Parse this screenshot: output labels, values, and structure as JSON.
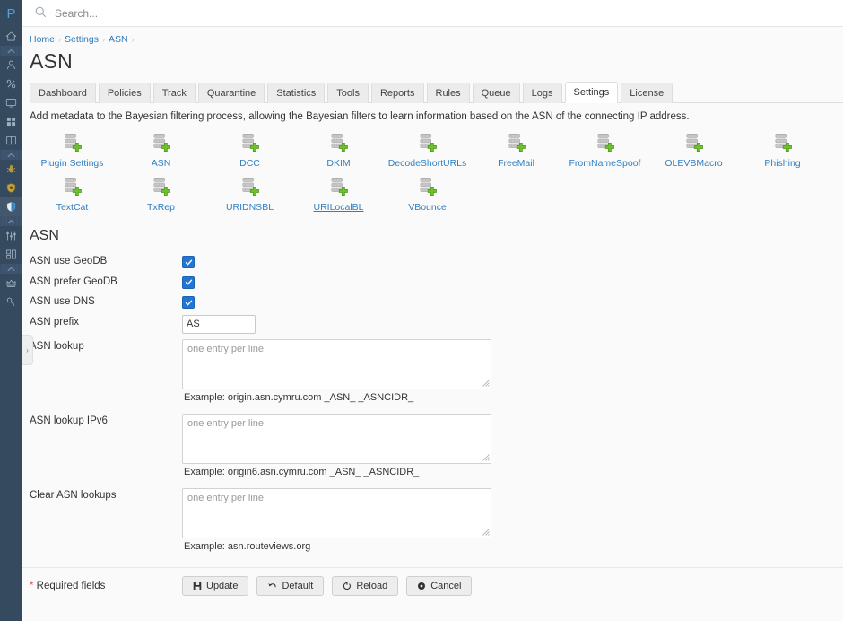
{
  "sidebar": {
    "logo": "P",
    "items": [
      {
        "name": "home-icon",
        "label": "Home",
        "type": "item",
        "active": false
      },
      {
        "name": "chevron-up-icon",
        "label": "",
        "type": "sep",
        "active": false
      },
      {
        "name": "user-icon",
        "label": "Users",
        "type": "item",
        "active": false
      },
      {
        "name": "percent-icon",
        "label": "Rates",
        "type": "item",
        "active": false
      },
      {
        "name": "monitor-icon",
        "label": "Monitor",
        "type": "item",
        "active": false
      },
      {
        "name": "grid-icon",
        "label": "Apps",
        "type": "item",
        "active": false
      },
      {
        "name": "book-icon",
        "label": "Docs",
        "type": "item",
        "active": false
      },
      {
        "name": "chevron-up-icon",
        "label": "",
        "type": "sep",
        "active": false
      },
      {
        "name": "bug-icon",
        "label": "Threats",
        "type": "item",
        "active": false
      },
      {
        "name": "virus-shield-icon",
        "label": "Antivirus",
        "type": "item",
        "active": false
      },
      {
        "name": "shield-icon",
        "label": "Protection",
        "type": "item",
        "active": true
      },
      {
        "name": "chevron-up-icon",
        "label": "",
        "type": "sep",
        "active": false
      },
      {
        "name": "sliders-icon",
        "label": "Settings",
        "type": "item",
        "active": false
      },
      {
        "name": "layout-icon",
        "label": "Layout",
        "type": "item",
        "active": false
      },
      {
        "name": "chevron-up-icon",
        "label": "",
        "type": "sep",
        "active": false
      },
      {
        "name": "crown-icon",
        "label": "License",
        "type": "item",
        "active": false
      },
      {
        "name": "key-icon",
        "label": "Keys",
        "type": "item",
        "active": false
      }
    ],
    "collapse_handle": "›"
  },
  "topbar": {
    "search_placeholder": "Search...",
    "search_value": ""
  },
  "breadcrumb": {
    "items": [
      "Home",
      "Settings",
      "ASN"
    ],
    "separator": "›"
  },
  "page": {
    "title": "ASN",
    "intro": "Add metadata to the Bayesian filtering process, allowing the Bayesian filters to learn information based on the ASN of the connecting IP address."
  },
  "tabs": [
    {
      "label": "Dashboard",
      "active": false
    },
    {
      "label": "Policies",
      "active": false
    },
    {
      "label": "Track",
      "active": false
    },
    {
      "label": "Quarantine",
      "active": false
    },
    {
      "label": "Statistics",
      "active": false
    },
    {
      "label": "Tools",
      "active": false
    },
    {
      "label": "Reports",
      "active": false
    },
    {
      "label": "Rules",
      "active": false
    },
    {
      "label": "Queue",
      "active": false
    },
    {
      "label": "Logs",
      "active": false
    },
    {
      "label": "Settings",
      "active": true
    },
    {
      "label": "License",
      "active": false
    }
  ],
  "plugins": [
    {
      "label": "Plugin Settings",
      "hover": false
    },
    {
      "label": "ASN",
      "hover": false
    },
    {
      "label": "DCC",
      "hover": false
    },
    {
      "label": "DKIM",
      "hover": false
    },
    {
      "label": "DecodeShortURLs",
      "hover": false
    },
    {
      "label": "FreeMail",
      "hover": false
    },
    {
      "label": "FromNameSpoof",
      "hover": false
    },
    {
      "label": "OLEVBMacro",
      "hover": false
    },
    {
      "label": "Phishing",
      "hover": false
    },
    {
      "label": "TextCat",
      "hover": false
    },
    {
      "label": "TxRep",
      "hover": false
    },
    {
      "label": "URIDNSBL",
      "hover": false
    },
    {
      "label": "URILocalBL",
      "hover": true
    },
    {
      "label": "VBounce",
      "hover": false
    }
  ],
  "form": {
    "section_title": "ASN",
    "fields": [
      {
        "label": "ASN use GeoDB",
        "type": "checkbox",
        "checked": true
      },
      {
        "label": "ASN prefer GeoDB",
        "type": "checkbox",
        "checked": true
      },
      {
        "label": "ASN use DNS",
        "type": "checkbox",
        "checked": true
      },
      {
        "label": "ASN prefix",
        "type": "text",
        "value": "AS",
        "placeholder": ""
      },
      {
        "label": "ASN lookup",
        "type": "textarea",
        "value": "",
        "placeholder": "one entry per line",
        "hint": "Example: origin.asn.cymru.com _ASN_ _ASNCIDR_"
      },
      {
        "label": "ASN lookup IPv6",
        "type": "textarea",
        "value": "",
        "placeholder": "one entry per line",
        "hint": "Example: origin6.asn.cymru.com _ASN_ _ASNCIDR_"
      },
      {
        "label": "Clear ASN lookups",
        "type": "textarea",
        "value": "",
        "placeholder": "one entry per line",
        "hint": "Example: asn.routeviews.org"
      }
    ],
    "required_note_star": "*",
    "required_note": " Required fields",
    "buttons": [
      {
        "label": "Update",
        "icon": "save-icon"
      },
      {
        "label": "Default",
        "icon": "undo-icon"
      },
      {
        "label": "Reload",
        "icon": "refresh-icon"
      },
      {
        "label": "Cancel",
        "icon": "cancel-icon"
      }
    ]
  },
  "colors": {
    "sidebar_bg": "#354a5f",
    "accent_link": "#2f7fc1",
    "checkbox": "#2176d4",
    "plugin_plus": "#67b32a",
    "required_star": "#d9534f"
  }
}
